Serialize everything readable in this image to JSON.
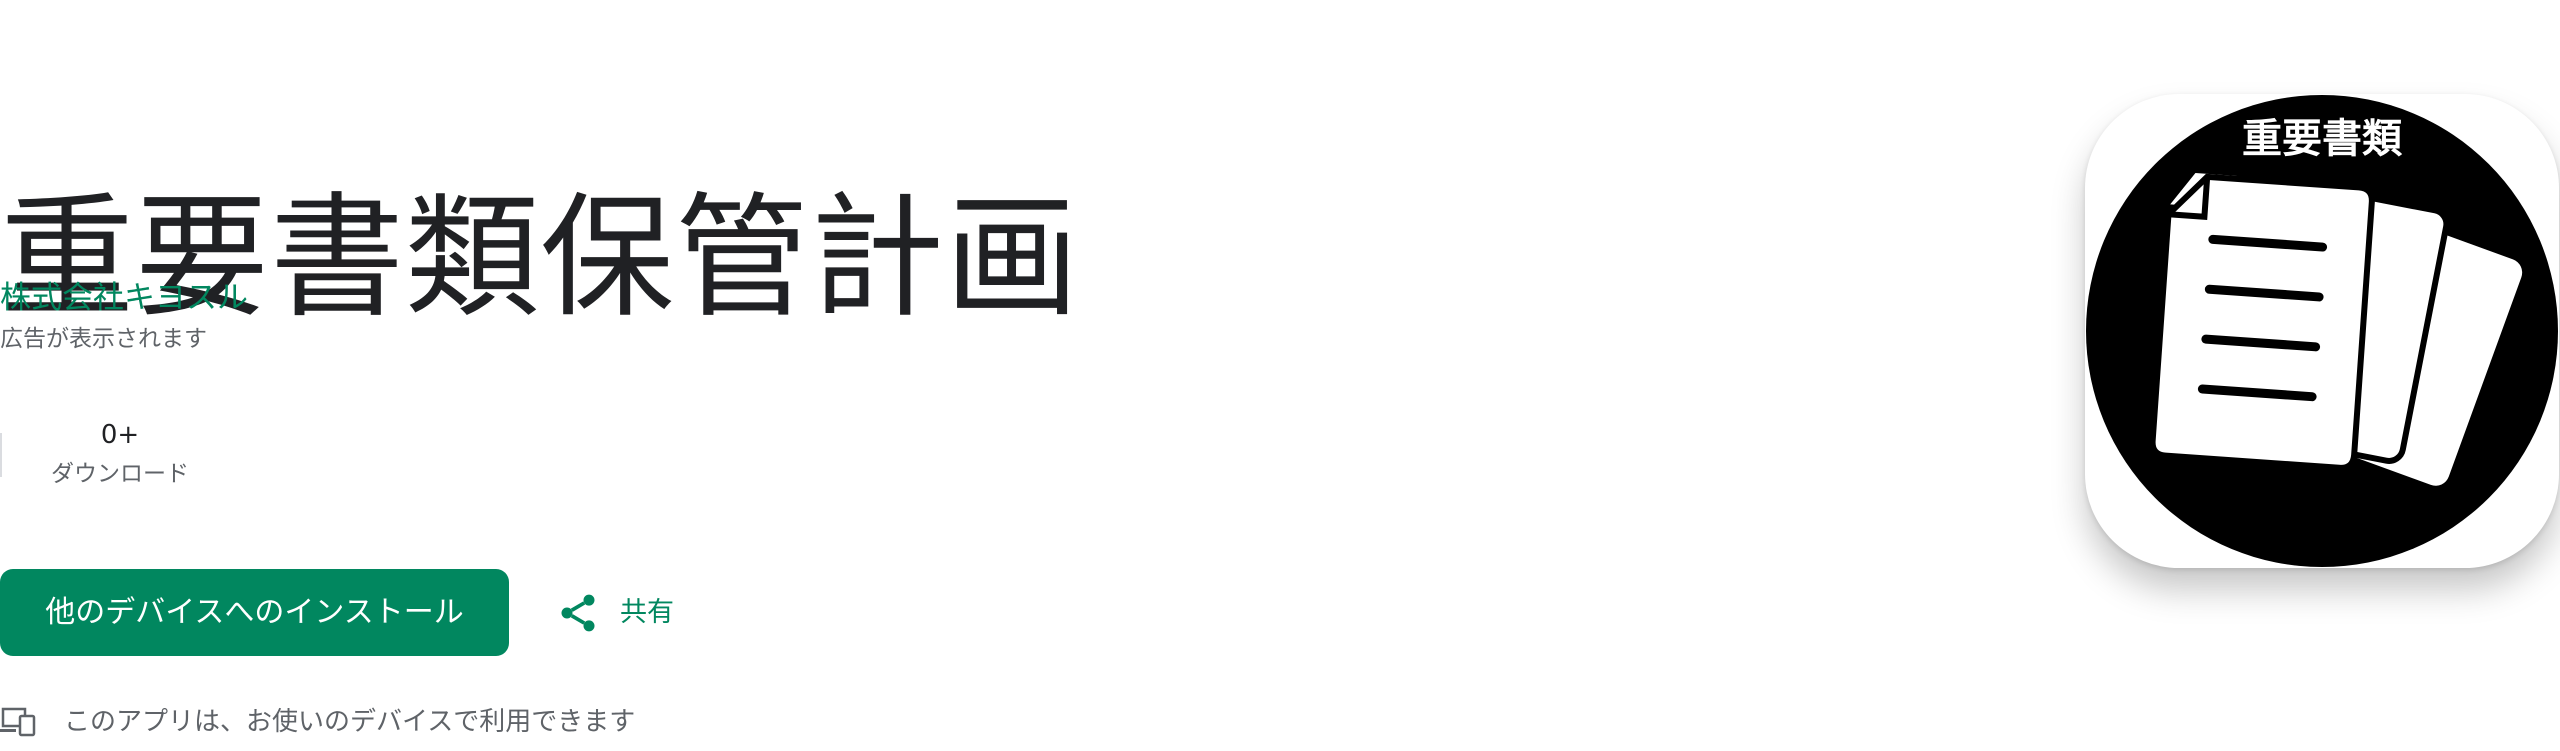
{
  "app": {
    "title": "重要書類保管計画",
    "developer": "株式会社キヨスル",
    "ads_notice": "広告が表示されます",
    "icon_label": "重要書類",
    "icon_name": "document-stack-icon"
  },
  "stats": [
    {
      "value": "0+",
      "label": "ダウンロード"
    }
  ],
  "actions": {
    "install_label": "他のデバイスへのインストール",
    "share_label": "共有",
    "share_icon": "share-icon"
  },
  "availability": {
    "icon": "devices-icon",
    "text": "このアプリは、お使いのデバイスで利用できます"
  },
  "colors": {
    "accent": "#01875f",
    "title_text": "#202124",
    "secondary_text": "#5f6368"
  }
}
